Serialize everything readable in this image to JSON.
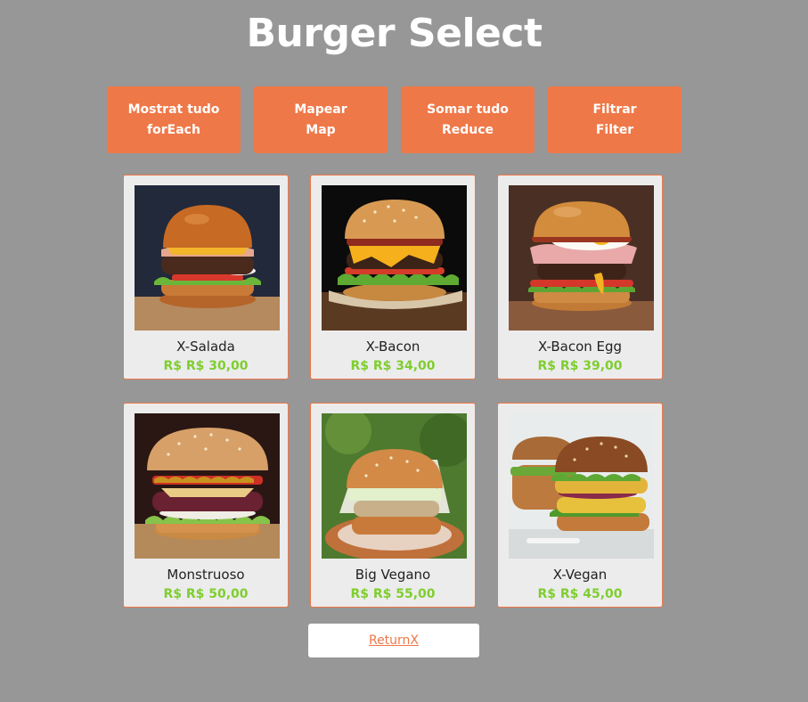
{
  "page": {
    "title": "Burger Select"
  },
  "buttons": [
    {
      "line1": "Mostrat tudo",
      "line2": "forEach"
    },
    {
      "line1": "Mapear",
      "line2": "Map"
    },
    {
      "line1": "Somar tudo",
      "line2": "Reduce"
    },
    {
      "line1": "Filtrar",
      "line2": "Filter"
    }
  ],
  "products": [
    {
      "name": "X-Salada",
      "price": "R$ R$ 30,00",
      "image": "burger-classic-photo"
    },
    {
      "name": "X-Bacon",
      "price": "R$ R$ 34,00",
      "image": "burger-bacon-photo"
    },
    {
      "name": "X-Bacon Egg",
      "price": "R$ R$ 39,00",
      "image": "burger-bacon-egg-photo"
    },
    {
      "name": "Monstruoso",
      "price": "R$ R$ 50,00",
      "image": "burger-monster-photo"
    },
    {
      "name": "Big Vegano",
      "price": "R$ R$ 55,00",
      "image": "burger-vegan-big-photo"
    },
    {
      "name": "X-Vegan",
      "price": "R$ R$ 45,00",
      "image": "burger-vegan-photo"
    }
  ],
  "footer": {
    "return_label": "ReturnX"
  },
  "colors": {
    "background": "#979797",
    "accent": "#ef7848",
    "price": "#7fce2f",
    "card": "#ececec"
  }
}
